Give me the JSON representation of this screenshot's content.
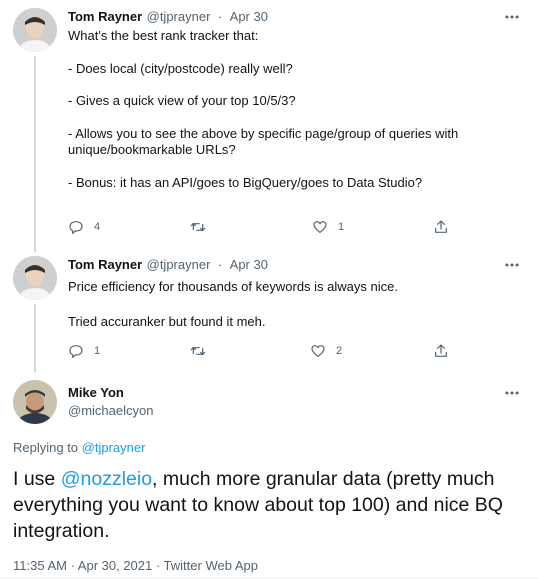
{
  "tweets": [
    {
      "name": "Tom Rayner",
      "handle": "@tjprayner",
      "separator": "·",
      "date": "Apr 30",
      "text": "What's the best rank tracker that:\n\n- Does local (city/postcode) really well?\n\n- Gives a quick view of your top 10/5/3?\n\n- Allows you to see the above by specific page/group of queries with unique/bookmarkable URLs?\n\n- Bonus: it has an API/goes to BigQuery/goes to Data Studio?",
      "replies": "4",
      "retweets": "",
      "likes": "1"
    },
    {
      "name": "Tom Rayner",
      "handle": "@tjprayner",
      "separator": "·",
      "date": "Apr 30",
      "text": "Price efficiency for thousands of keywords is always nice.\n\nTried accuranker but found it meh.",
      "replies": "1",
      "retweets": "",
      "likes": "2"
    }
  ],
  "main_tweet": {
    "name": "Mike Yon",
    "handle": "@michaelcyon",
    "replying_prefix": "Replying to ",
    "replying_handle": "@tjprayner",
    "mention": "@nozzleio",
    "text_before": "I use ",
    "text_after": ", much more granular data (pretty much everything you want to know about top 100) and nice BQ integration.",
    "meta": "11:35 AM · Apr 30, 2021 · Twitter Web App"
  },
  "colors": {
    "text": "#0f1419",
    "secondary": "#536471",
    "link": "#1d9bf0",
    "thread_line": "#cfd9de"
  },
  "icons": [
    "more-icon",
    "reply-icon",
    "retweet-icon",
    "like-icon",
    "share-icon"
  ]
}
